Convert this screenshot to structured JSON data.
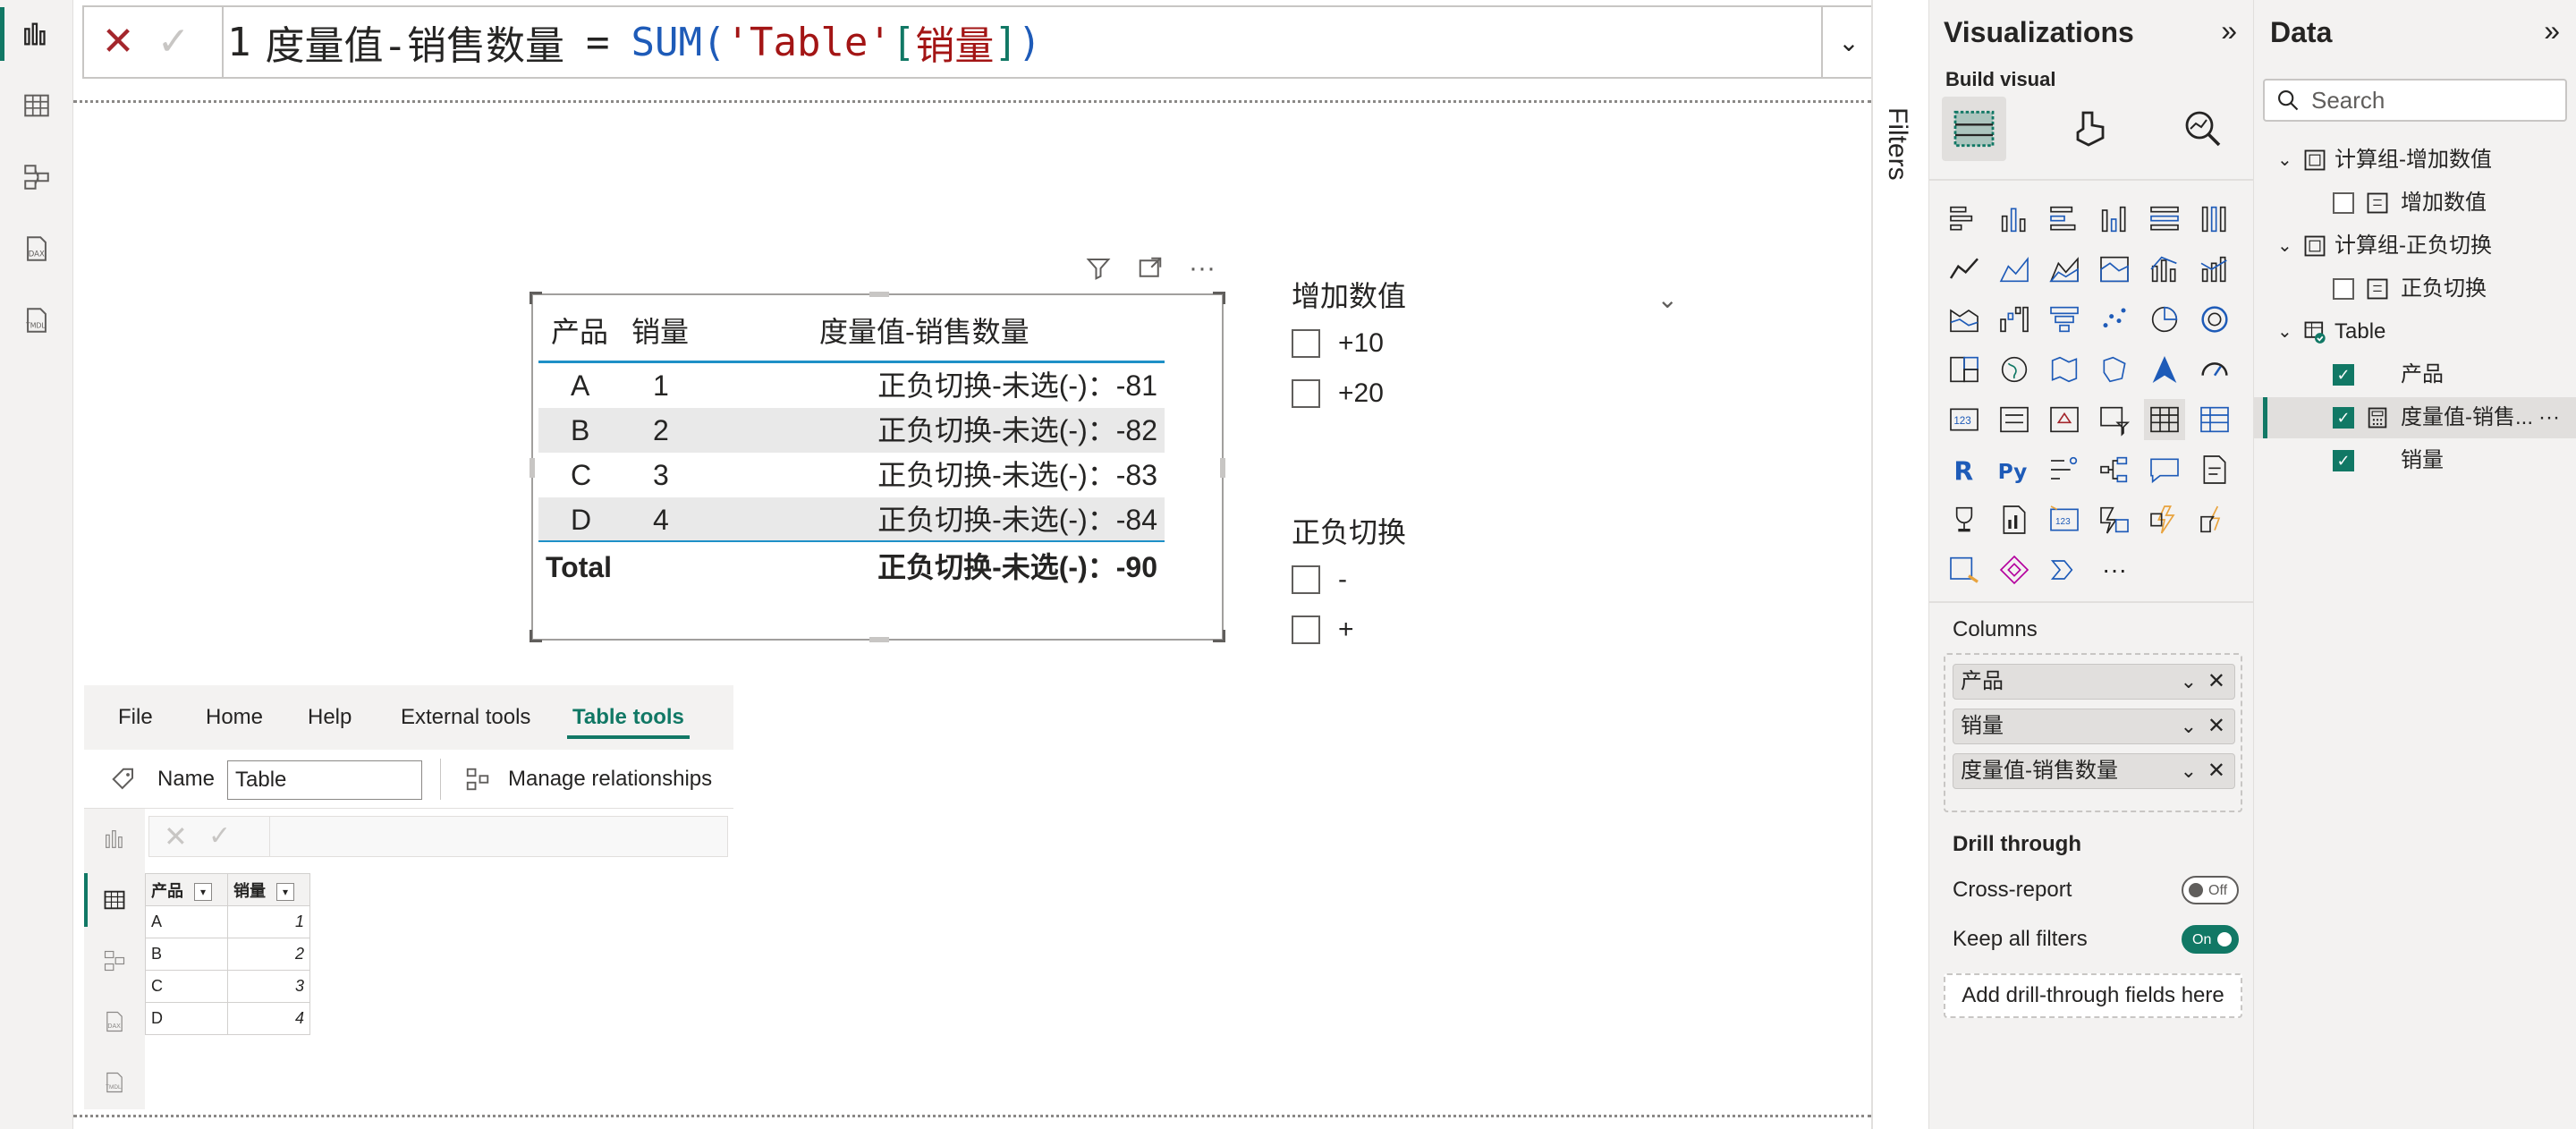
{
  "formula": {
    "line_no": "1",
    "measure": "度量值-销售数量",
    "eq": "=",
    "func": "SUM(",
    "table": "'Table'",
    "col_open": "[",
    "col": "销量",
    "col_close": "]",
    "close": ")"
  },
  "table_visual": {
    "headers": [
      "产品",
      "销量",
      "度量值-销售数量"
    ],
    "rows": [
      {
        "p": "A",
        "q": "1",
        "m": "正负切换-未选(-)：-81"
      },
      {
        "p": "B",
        "q": "2",
        "m": "正负切换-未选(-)：-82"
      },
      {
        "p": "C",
        "q": "3",
        "m": "正负切换-未选(-)：-83"
      },
      {
        "p": "D",
        "q": "4",
        "m": "正负切换-未选(-)：-84"
      }
    ],
    "total_label": "Total",
    "total_value": "正负切换-未选(-)：-90"
  },
  "slicer1": {
    "title": "增加数值",
    "items": [
      "+10",
      "+20"
    ]
  },
  "slicer2": {
    "title": "正负切换",
    "items": [
      "-",
      "+"
    ]
  },
  "mini": {
    "tabs": [
      "File",
      "Home",
      "Help",
      "External tools",
      "Table tools"
    ],
    "name_label": "Name",
    "name_value": "Table",
    "manage_rel": "Manage relationships",
    "grid_headers": [
      "产品",
      "销量"
    ],
    "grid_rows": [
      [
        "A",
        "1"
      ],
      [
        "B",
        "2"
      ],
      [
        "C",
        "3"
      ],
      [
        "D",
        "4"
      ]
    ]
  },
  "filters_label": "Filters",
  "viz": {
    "title": "Visualizations",
    "build": "Build visual",
    "columns_label": "Columns",
    "fields": [
      "产品",
      "销量",
      "度量值-销售数量"
    ],
    "drill_title": "Drill through",
    "cross_report": "Cross-report",
    "cross_toggle": "Off",
    "keep_filters": "Keep all filters",
    "keep_toggle": "On",
    "drill_add": "Add drill-through fields here",
    "more": "···"
  },
  "data": {
    "title": "Data",
    "search_placeholder": "Search",
    "group1": "计算组-增加数值",
    "group1_item": "增加数值",
    "group2": "计算组-正负切换",
    "group2_item": "正负切换",
    "table": "Table",
    "table_items": [
      "产品",
      "度量值-销售...",
      "销量"
    ],
    "more": "···"
  },
  "colors": {
    "accent": "#117865",
    "cancel": "#a4262c",
    "func": "#1e5bb8",
    "string": "#a31515"
  }
}
